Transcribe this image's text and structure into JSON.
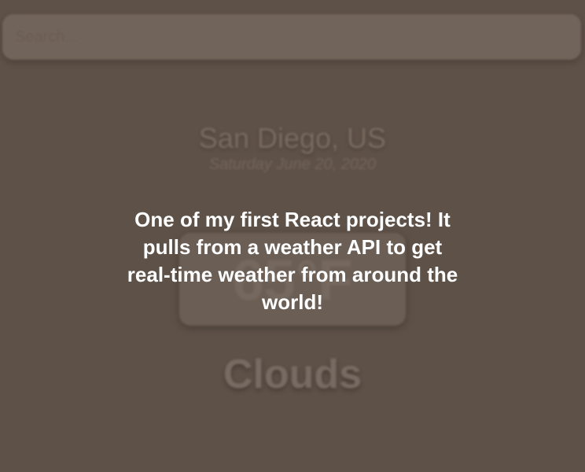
{
  "search": {
    "placeholder": "Search..."
  },
  "weather": {
    "location": "San Diego, US",
    "date": "Saturday June 20, 2020",
    "temperature": "65°F",
    "condition": "Clouds"
  },
  "overlay": {
    "description": "One of my first React projects!  It\npulls from a weather API  to get\nreal-time weather from around the\nworld!"
  },
  "colors": {
    "background": "#5f5249",
    "overlay_text": "#ffffff"
  }
}
